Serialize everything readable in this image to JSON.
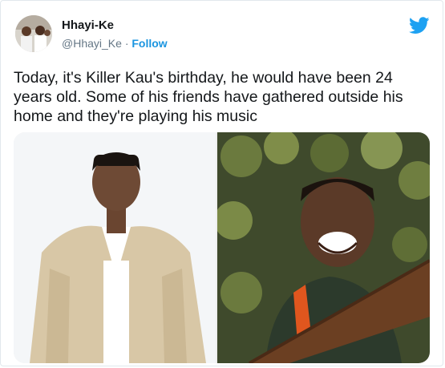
{
  "tweet": {
    "author_name": "Hhayi-Ke",
    "handle": "@Hhayi_Ke",
    "separator": "·",
    "follow_label": "Follow",
    "text": "Today, it's Killer Kau's birthday, he would have been 24 years old. Some of his friends have gathered outside his home and they're playing his music",
    "brand_icon": "twitter-bird-icon",
    "colors": {
      "accent": "#1b95e0",
      "bird": "#1da1f2",
      "text": "#14171a",
      "muted": "#657786"
    }
  }
}
